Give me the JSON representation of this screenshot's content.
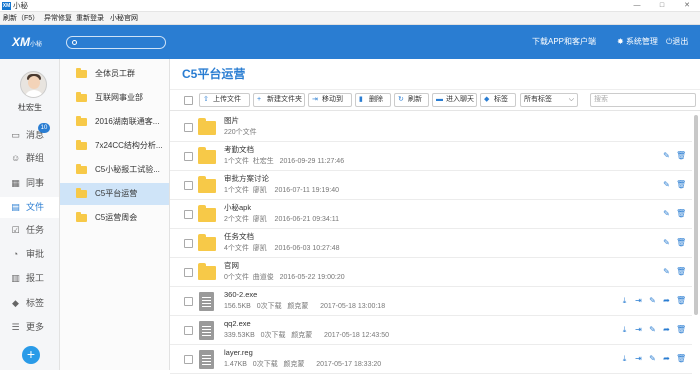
{
  "window": {
    "logo": "XM",
    "title": "小秘",
    "controls": [
      "—",
      "□",
      "✕"
    ]
  },
  "menu": [
    "刷新（F5）",
    "异常修复",
    "重新登录",
    "小秘官网"
  ],
  "header": {
    "brand": "XM",
    "brand_sub": "小秘",
    "download": "下载APP和客户端",
    "settings": "系统管理",
    "exit": "退出"
  },
  "user": {
    "name": "杜宏生"
  },
  "nav": [
    {
      "label": "消息",
      "icon": "message-icon",
      "glyph": "▭",
      "badge": "10"
    },
    {
      "label": "群组",
      "icon": "group-icon",
      "glyph": "☺"
    },
    {
      "label": "同事",
      "icon": "colleague-icon",
      "glyph": "▦"
    },
    {
      "label": "文件",
      "icon": "file-icon",
      "glyph": "▤",
      "active": true
    },
    {
      "label": "任务",
      "icon": "task-icon",
      "glyph": "☑"
    },
    {
      "label": "审批",
      "icon": "approval-icon",
      "glyph": "◔"
    },
    {
      "label": "报工",
      "icon": "report-icon",
      "glyph": "▥"
    },
    {
      "label": "标签",
      "icon": "tag-icon",
      "glyph": "◆"
    },
    {
      "label": "更多",
      "icon": "more-icon",
      "glyph": "☰"
    }
  ],
  "folders": [
    "全体员工群",
    "互联网事业部",
    "2016湖南联通客...",
    "7x24CC结构分析...",
    "C5小秘报工试验...",
    "C5平台运营",
    "C5运营周会"
  ],
  "active_folder": "C5平台运营",
  "main": {
    "title": "C5平台运营",
    "toolbar": [
      {
        "label": "上传文件",
        "glyph": "⇧"
      },
      {
        "label": "新建文件夹",
        "glyph": "+"
      },
      {
        "label": "移动到",
        "glyph": "⇥"
      },
      {
        "label": "删除",
        "glyph": "▮"
      },
      {
        "label": "刷新",
        "glyph": "↻"
      },
      {
        "label": "进入聊天",
        "glyph": "▬"
      },
      {
        "label": "标签",
        "glyph": "◆"
      }
    ],
    "tag_select": "所有标签",
    "search_placeholder": "搜索",
    "rows": [
      {
        "type": "folder",
        "name": "图片",
        "meta": "220个文件",
        "actions": []
      },
      {
        "type": "folder",
        "name": "考勤文档",
        "meta": "1个文件  杜宏生   2016-09-29 11:27:46",
        "actions": [
          "✎",
          "🗑"
        ]
      },
      {
        "type": "folder",
        "name": "审批方案讨论",
        "meta": "1个文件  廖凯    2016-07-11 19:19:40",
        "actions": [
          "✎",
          "🗑"
        ]
      },
      {
        "type": "folder",
        "name": "小秘apk",
        "meta": "2个文件  廖凯    2016-06-21 09:34:11",
        "actions": [
          "✎",
          "🗑"
        ]
      },
      {
        "type": "folder",
        "name": "任务文档",
        "meta": "4个文件  廖凯    2016-06-03 10:27:48",
        "actions": [
          "✎",
          "🗑"
        ]
      },
      {
        "type": "folder",
        "name": "官网",
        "meta": "0个文件  曲道俊   2016-05-22 19:00:20",
        "actions": [
          "✎",
          "🗑"
        ]
      },
      {
        "type": "file",
        "name": "360-2.exe",
        "meta": "156.5KB   0次下载   颜克蒙      2017-05-18 13:00:18",
        "actions": [
          "⤓",
          "⇥",
          "✎",
          "➦",
          "🗑"
        ]
      },
      {
        "type": "file",
        "name": "qq2.exe",
        "meta": "339.53KB   0次下载   颜克蒙      2017-05-18 12:43:50",
        "actions": [
          "⤓",
          "⇥",
          "✎",
          "➦",
          "🗑"
        ]
      },
      {
        "type": "file",
        "name": "layer.reg",
        "meta": "1.47KB   0次下载   颜克蒙      2017-05-17 18:33:20",
        "actions": [
          "⤓",
          "⇥",
          "✎",
          "➦",
          "🗑"
        ]
      }
    ]
  },
  "colors": {
    "accent": "#2a7dd2",
    "folder": "#f7c948",
    "active_folder_bg": "#cfe4f8"
  }
}
